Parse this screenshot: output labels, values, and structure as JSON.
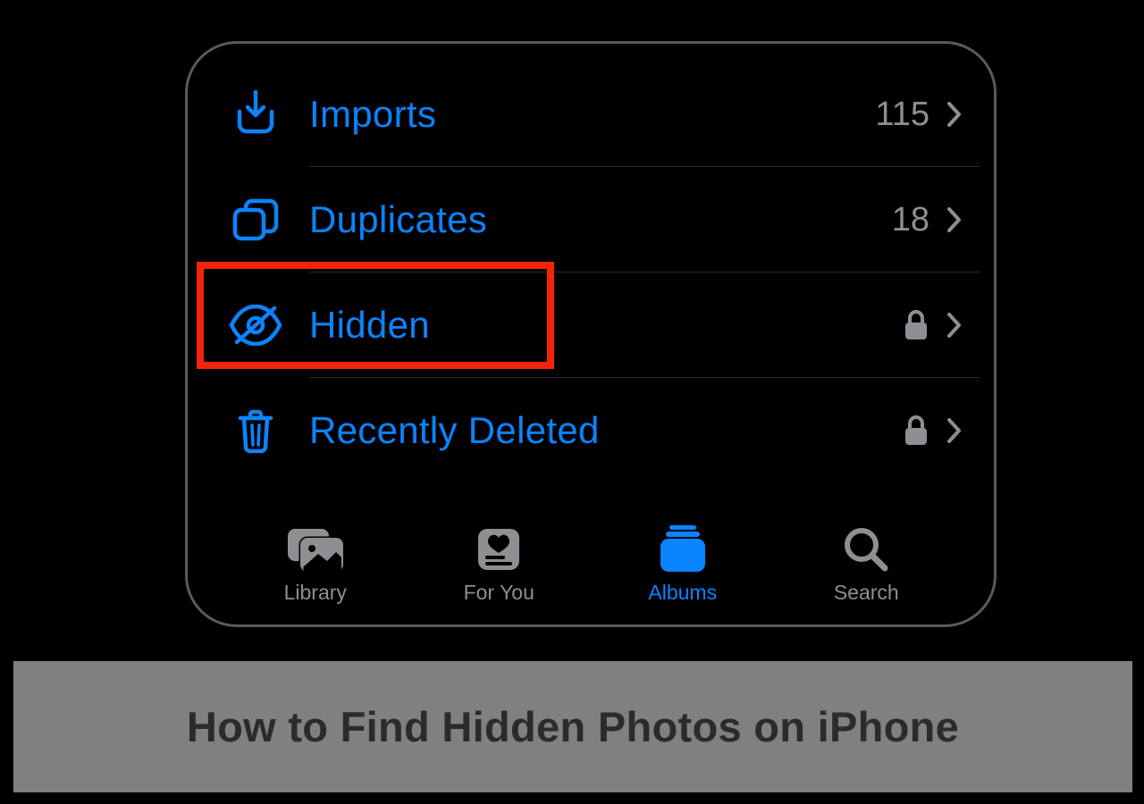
{
  "colors": {
    "accent": "#0a84ff",
    "muted": "#8e8e93",
    "highlight": "#f4240b"
  },
  "rows": [
    {
      "icon": "download-icon",
      "label": "Imports",
      "count": "115",
      "locked": false
    },
    {
      "icon": "duplicate-icon",
      "label": "Duplicates",
      "count": "18",
      "locked": false
    },
    {
      "icon": "eye-slash-icon",
      "label": "Hidden",
      "count": "",
      "locked": true,
      "highlighted": true
    },
    {
      "icon": "trash-icon",
      "label": "Recently Deleted",
      "count": "",
      "locked": true
    }
  ],
  "tabs": [
    {
      "icon": "library-icon",
      "label": "Library",
      "active": false
    },
    {
      "icon": "foryou-icon",
      "label": "For You",
      "active": false
    },
    {
      "icon": "albums-icon",
      "label": "Albums",
      "active": true
    },
    {
      "icon": "search-icon",
      "label": "Search",
      "active": false
    }
  ],
  "caption": "How to Find Hidden Photos on iPhone"
}
